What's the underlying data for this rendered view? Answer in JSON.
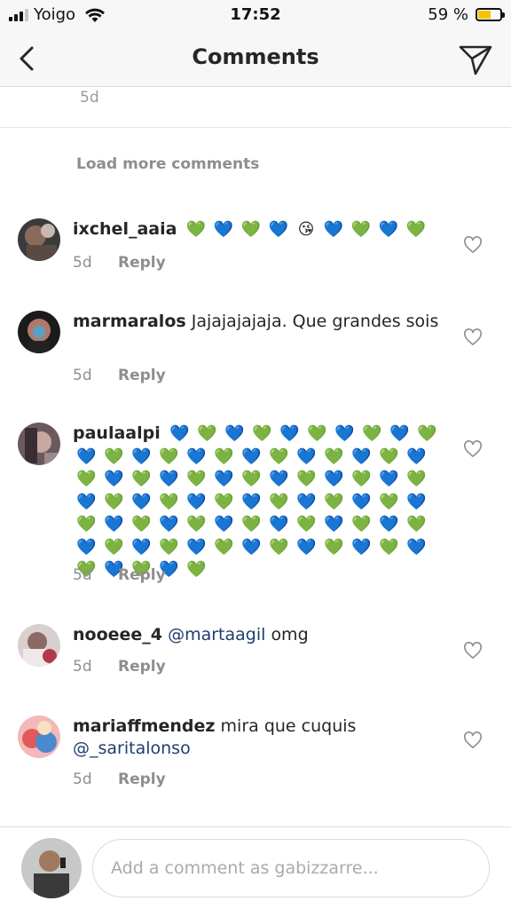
{
  "status_bar": {
    "carrier": "Yoigo",
    "time": "17:52",
    "battery_percent": "59 %",
    "battery_level": 0.59,
    "battery_color": "#f5c400"
  },
  "nav": {
    "title": "Comments",
    "back_icon": "chevron-left-icon",
    "send_icon": "paper-plane-icon"
  },
  "partial_comment": {
    "age": "5d"
  },
  "load_more": "Load more comments",
  "comments": [
    {
      "username": "ixchel_aaia",
      "text": "",
      "hearts": [
        "g",
        "b",
        "g",
        "b",
        "kiss",
        "b",
        "g",
        "b",
        "g"
      ],
      "age": "5d",
      "reply": "Reply"
    },
    {
      "username": "marmaralos",
      "text": "Jajajajajaja. Que grandes sois",
      "age": "5d",
      "reply": "Reply"
    },
    {
      "username": "paulaalpi",
      "text": "",
      "hearts": [
        "b",
        "g",
        "b",
        "g",
        "b",
        "g",
        "b",
        "g",
        "b",
        "g",
        "b",
        "g",
        "b",
        "g",
        "b",
        "g",
        "b",
        "g",
        "b",
        "g",
        "b",
        "g",
        "b",
        "g",
        "b",
        "g",
        "b",
        "g",
        "b",
        "g",
        "b",
        "g",
        "b",
        "g",
        "b",
        "g",
        "b",
        "g",
        "b",
        "g",
        "b",
        "g",
        "b",
        "g",
        "b",
        "g",
        "b",
        "g",
        "b",
        "g",
        "b",
        "g",
        "b",
        "g",
        "b",
        "g",
        "b",
        "g",
        "b",
        "g",
        "b",
        "g",
        "b",
        "g",
        "b",
        "g",
        "b",
        "g",
        "b",
        "g",
        "b",
        "g",
        "b",
        "g",
        "b",
        "g",
        "b",
        "g",
        "b",
        "g"
      ],
      "age": "5d",
      "reply": "Reply"
    },
    {
      "username": "nooeee_4",
      "mention": "@martaagil",
      "text": "omg",
      "age": "5d",
      "reply": "Reply"
    },
    {
      "username": "mariaffmendez",
      "text": "mira que cuquis",
      "mention": "@_saritalonso",
      "age": "5d",
      "reply": "Reply"
    }
  ],
  "composer": {
    "placeholder": "Add a comment as gabizzarre..."
  },
  "colors": {
    "green_heart": "#4cbb2c",
    "blue_heart": "#1f6fe0",
    "mention": "#1e3e6e"
  }
}
